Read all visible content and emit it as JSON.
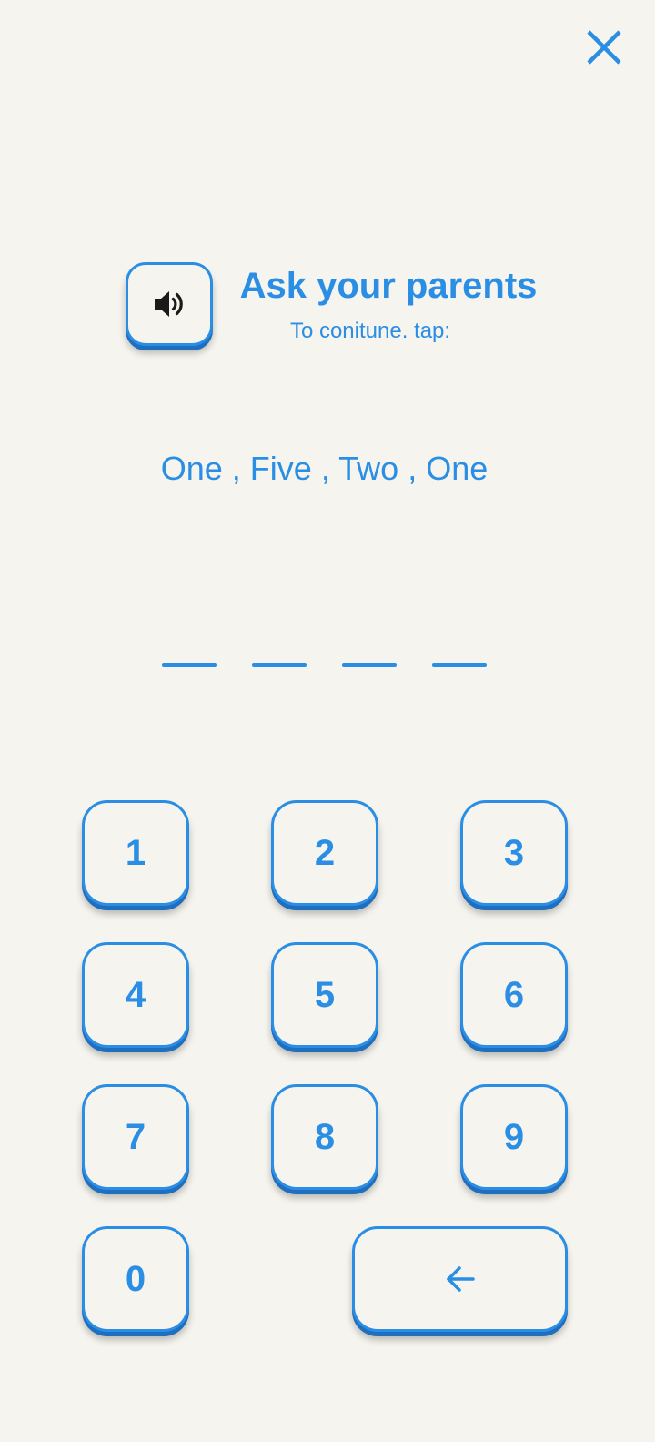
{
  "header": {
    "close_icon": "close-icon",
    "speaker_icon": "speaker-icon",
    "title": "Ask your parents",
    "subtitle": "To conitune. tap:"
  },
  "challenge": {
    "words": "One , Five , Two , One",
    "entered_digits": 0,
    "total_digits": 4
  },
  "keypad": {
    "keys": [
      "1",
      "2",
      "3",
      "4",
      "5",
      "6",
      "7",
      "8",
      "9",
      "0"
    ],
    "backspace_icon": "arrow-left-icon"
  },
  "colors": {
    "accent": "#2a8ee4",
    "accent_shadow": "#1f6fc0",
    "background": "#f6f4ee",
    "icon_dark": "#1a1a1a"
  }
}
